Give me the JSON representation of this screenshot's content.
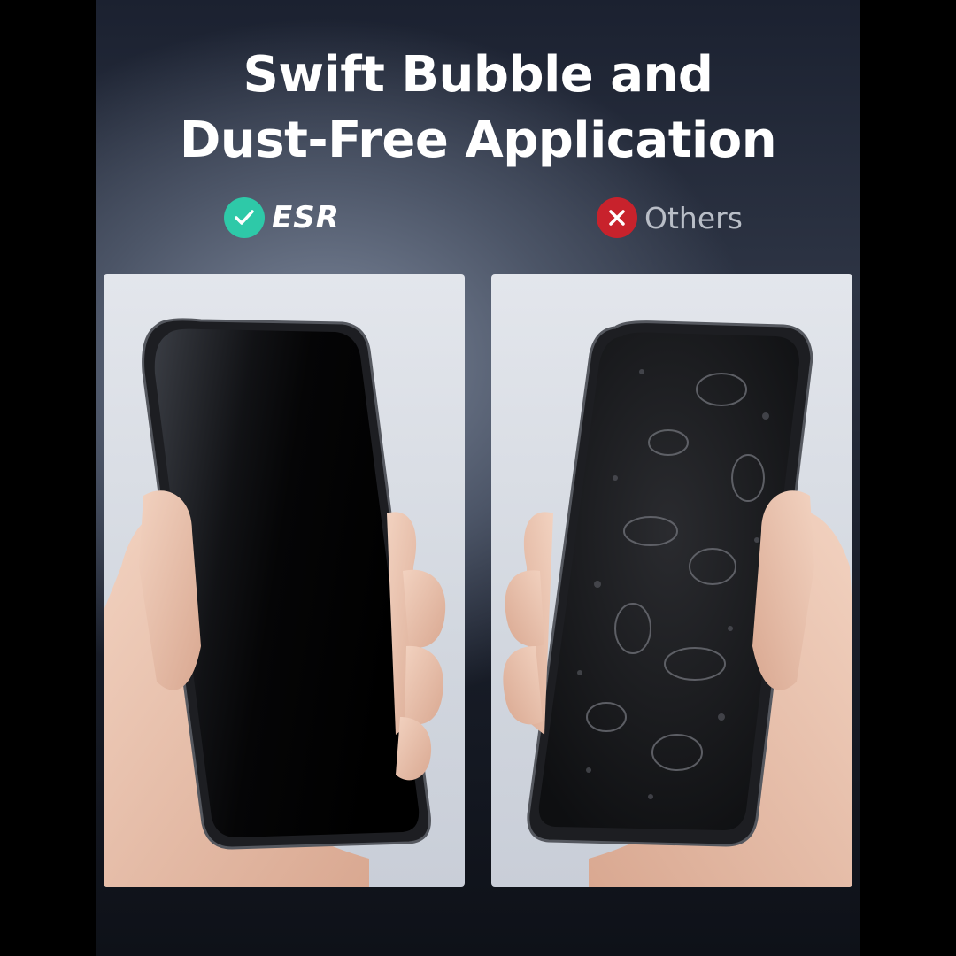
{
  "headline": {
    "line1": "Swift Bubble and",
    "line2": "Dust-Free Application"
  },
  "comparison": {
    "good": {
      "label": "ESR",
      "icon": "check-icon",
      "color": "#2ec9a8"
    },
    "bad": {
      "label": "Others",
      "icon": "x-icon",
      "color": "#c8222c"
    }
  },
  "photos": {
    "left": "Phone held in hand with clean screen protector",
    "right": "Phone held in hand with bubbled screen protector"
  }
}
